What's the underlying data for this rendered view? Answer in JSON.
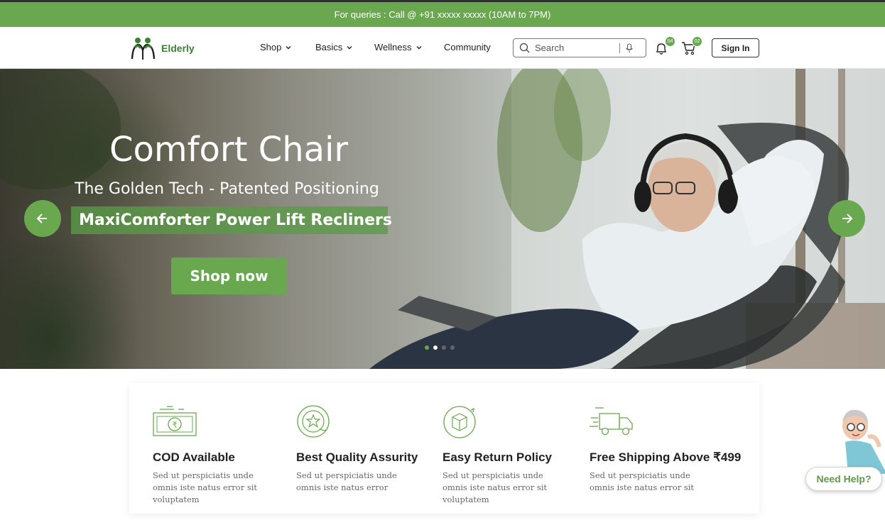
{
  "topbar": {
    "text": "For queries : Call @ +91 xxxxx xxxxx (10AM to 7PM)"
  },
  "header": {
    "logo": {
      "text": "Elderly",
      "icon": "elderly-couple-logo"
    },
    "menu": [
      {
        "label": "Shop",
        "dropdown": true
      },
      {
        "label": "Basics",
        "dropdown": true
      },
      {
        "label": "Wellness",
        "dropdown": true
      },
      {
        "label": "Community",
        "dropdown": false
      }
    ],
    "search": {
      "placeholder": "Search",
      "value": ""
    },
    "notifications": {
      "count": "04",
      "icon": "bell-icon"
    },
    "cart": {
      "count": "02",
      "icon": "cart-icon"
    },
    "signin_label": "Sign In"
  },
  "hero": {
    "title": "Comfort Chair",
    "subtitle": "The Golden Tech - Patented Positioning",
    "highlight": "MaxiComforter Power Lift Recliners",
    "cta": "Shop now",
    "slides": {
      "total": 4,
      "active": 1
    }
  },
  "features": [
    {
      "icon": "cash-rupee-icon",
      "title": "COD Available",
      "desc": "Sed ut perspiciatis unde omnis iste natus error sit voluptatem"
    },
    {
      "icon": "quality-star-badge-icon",
      "title": "Best Quality Assurity",
      "desc": "Sed ut perspiciatis unde omnis iste natus error"
    },
    {
      "icon": "return-box-icon",
      "title": "Easy Return Policy",
      "desc": "Sed ut perspiciatis unde omnis iste natus error sit voluptatem"
    },
    {
      "icon": "delivery-truck-icon",
      "title": "Free Shipping Above ₹499",
      "desc": "Sed ut perspiciatis unde omnis iste natus error sit"
    }
  ],
  "help": {
    "label": "Need Help?"
  },
  "colors": {
    "brand_green": "#6aa84f",
    "logo_green": "#3f7e35",
    "text_dark": "#222222",
    "text_muted": "#666666"
  }
}
